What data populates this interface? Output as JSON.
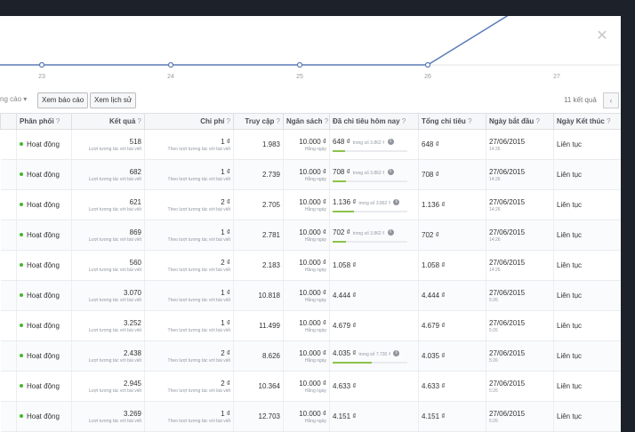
{
  "chart": {
    "x_labels": [
      "23",
      "24",
      "25",
      "26",
      "27"
    ],
    "colors": {
      "line": "#5b7bb8",
      "grid": "#e5e5e5"
    }
  },
  "toolbar": {
    "cut_label": "ng cáo",
    "view_report": "Xem báo cáo",
    "view_history": "Xem lịch sử",
    "result_count": "11 kết quả",
    "prev_icon": "‹"
  },
  "table": {
    "headers": {
      "delivery": "Phân phối",
      "results": "Kết quả",
      "cost": "Chi phí",
      "reach": "Truy cập",
      "budget": "Ngân sách",
      "spent_today": "Đã chi tiêu hôm nay",
      "total_spent": "Tổng chi tiêu",
      "start_date": "Ngày bắt đầu",
      "end_date": "Ngày Kết thúc"
    },
    "rows": [
      {
        "status": "Hoạt động",
        "results": "518",
        "result_sub": "Lượt tương tác với bài viết",
        "cost": "1 ₫",
        "cost_sub": "Theo lượt tương tác với bài viết",
        "reach": "1.983",
        "budget": "10.000 ₫",
        "budget_sub": "Hằng ngày",
        "spent": "648 ₫",
        "spent_of": "trong số 3.862 ₫",
        "spent_progress": 0.17,
        "total": "648 ₫",
        "start": "27/06/2015",
        "start_time": "14:26",
        "end": "Liên tục"
      },
      {
        "status": "Hoạt động",
        "results": "682",
        "result_sub": "Lượt tương tác với bài viết",
        "cost": "1 ₫",
        "cost_sub": "Theo lượt tương tác với bài viết",
        "reach": "2.739",
        "budget": "10.000 ₫",
        "budget_sub": "Hằng ngày",
        "spent": "708 ₫",
        "spent_of": "trong số 3.862 ₫",
        "spent_progress": 0.18,
        "total": "708 ₫",
        "start": "27/06/2015",
        "start_time": "14:26",
        "end": "Liên tục"
      },
      {
        "status": "Hoạt động",
        "results": "621",
        "result_sub": "Lượt tương tác với bài viết",
        "cost": "2 ₫",
        "cost_sub": "Theo lượt tương tác với bài viết",
        "reach": "2.705",
        "budget": "10.000 ₫",
        "budget_sub": "Hằng ngày",
        "spent": "1.136 ₫",
        "spent_of": "trong số 3.862 ₫",
        "spent_progress": 0.29,
        "total": "1.136 ₫",
        "start": "27/06/2015",
        "start_time": "14:26",
        "end": "Liên tục"
      },
      {
        "status": "Hoạt động",
        "results": "869",
        "result_sub": "Lượt tương tác với bài viết",
        "cost": "1 ₫",
        "cost_sub": "Theo lượt tương tác với bài viết",
        "reach": "2.781",
        "budget": "10.000 ₫",
        "budget_sub": "Hằng ngày",
        "spent": "702 ₫",
        "spent_of": "trong số 3.862 ₫",
        "spent_progress": 0.18,
        "total": "702 ₫",
        "start": "27/06/2015",
        "start_time": "14:26",
        "end": "Liên tục"
      },
      {
        "status": "Hoạt động",
        "results": "560",
        "result_sub": "Lượt tương tác với bài viết",
        "cost": "2 ₫",
        "cost_sub": "Theo lượt tương tác với bài viết",
        "reach": "2.183",
        "budget": "10.000 ₫",
        "budget_sub": "Hằng ngày",
        "spent": "1.058 ₫",
        "spent_of": "",
        "spent_progress": null,
        "total": "1.058 ₫",
        "start": "27/06/2015",
        "start_time": "14:26",
        "end": "Liên tục"
      },
      {
        "status": "Hoạt động",
        "results": "3.070",
        "result_sub": "Lượt tương tác với bài viết",
        "cost": "1 ₫",
        "cost_sub": "Theo lượt tương tác với bài viết",
        "reach": "10.818",
        "budget": "10.000 ₫",
        "budget_sub": "Hằng ngày",
        "spent": "4.444 ₫",
        "spent_of": "",
        "spent_progress": null,
        "total": "4.444 ₫",
        "start": "27/06/2015",
        "start_time": "5:26",
        "end": "Liên tục"
      },
      {
        "status": "Hoạt động",
        "results": "3.252",
        "result_sub": "Lượt tương tác với bài viết",
        "cost": "1 ₫",
        "cost_sub": "Theo lượt tương tác với bài viết",
        "reach": "11.499",
        "budget": "10.000 ₫",
        "budget_sub": "Hằng ngày",
        "spent": "4.679 ₫",
        "spent_of": "",
        "spent_progress": null,
        "total": "4.679 ₫",
        "start": "27/06/2015",
        "start_time": "5:26",
        "end": "Liên tục"
      },
      {
        "status": "Hoạt động",
        "results": "2.438",
        "result_sub": "Lượt tương tác với bài viết",
        "cost": "2 ₫",
        "cost_sub": "Theo lượt tương tác với bài viết",
        "reach": "8.626",
        "budget": "10.000 ₫",
        "budget_sub": "Hằng ngày",
        "spent": "4.035 ₫",
        "spent_of": "trong số 7.730 ₫",
        "spent_progress": 0.52,
        "total": "4.035 ₫",
        "start": "27/06/2015",
        "start_time": "5:26",
        "end": "Liên tục"
      },
      {
        "status": "Hoạt động",
        "results": "2.945",
        "result_sub": "Lượt tương tác với bài viết",
        "cost": "2 ₫",
        "cost_sub": "Theo lượt tương tác với bài viết",
        "reach": "10.364",
        "budget": "10.000 ₫",
        "budget_sub": "Hằng ngày",
        "spent": "4.633 ₫",
        "spent_of": "",
        "spent_progress": null,
        "total": "4.633 ₫",
        "start": "27/06/2015",
        "start_time": "5:26",
        "end": "Liên tục"
      },
      {
        "status": "Hoạt động",
        "results": "3.269",
        "result_sub": "Lượt tương tác với bài viết",
        "cost": "1 ₫",
        "cost_sub": "Theo lượt tương tác với bài viết",
        "reach": "12.703",
        "budget": "10.000 ₫",
        "budget_sub": "Hằng ngày",
        "spent": "4.151 ₫",
        "spent_of": "",
        "spent_progress": null,
        "total": "4.151 ₫",
        "start": "27/06/2015",
        "start_time": "5:26",
        "end": "Liên tục"
      }
    ]
  }
}
